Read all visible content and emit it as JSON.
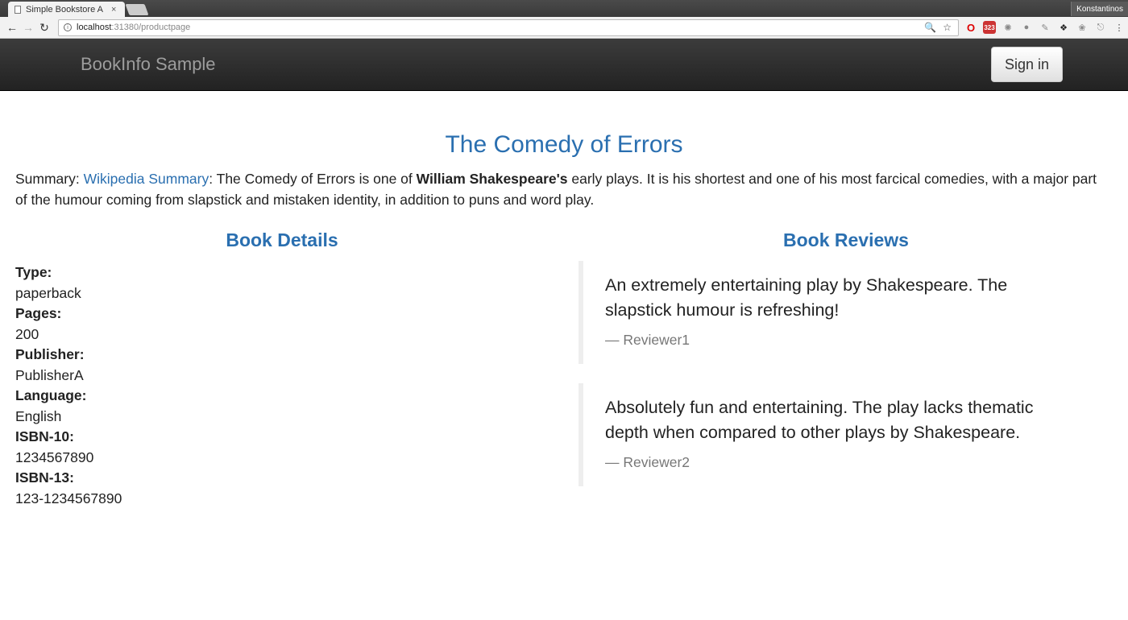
{
  "browser": {
    "tab_title": "Simple Bookstore A",
    "tab_close": "×",
    "profile_name": "Konstantinos",
    "url_host": "localhost",
    "url_rest": ":31380/productpage",
    "gmail_count": "323"
  },
  "navbar": {
    "brand": "BookInfo Sample",
    "signin_label": "Sign in"
  },
  "book": {
    "title": "The Comedy of Errors",
    "summary_prefix": "Summary: ",
    "summary_link": "Wikipedia Summary",
    "summary_mid": ": The Comedy of Errors is one of ",
    "summary_bold": "William Shakespeare's",
    "summary_rest": " early plays. It is his shortest and one of his most farcical comedies, with a major part of the humour coming from slapstick and mistaken identity, in addition to puns and word play."
  },
  "details": {
    "heading": "Book Details",
    "items": [
      {
        "label": "Type:",
        "value": "paperback"
      },
      {
        "label": "Pages:",
        "value": "200"
      },
      {
        "label": "Publisher:",
        "value": "PublisherA"
      },
      {
        "label": "Language:",
        "value": "English"
      },
      {
        "label": "ISBN-10:",
        "value": "1234567890"
      },
      {
        "label": "ISBN-13:",
        "value": "123-1234567890"
      }
    ]
  },
  "reviews": {
    "heading": "Book Reviews",
    "items": [
      {
        "text": "An extremely entertaining play by Shakespeare. The slapstick humour is refreshing!",
        "author": "— Reviewer1"
      },
      {
        "text": "Absolutely fun and entertaining. The play lacks thematic depth when compared to other plays by Shakespeare.",
        "author": "— Reviewer2"
      }
    ]
  }
}
